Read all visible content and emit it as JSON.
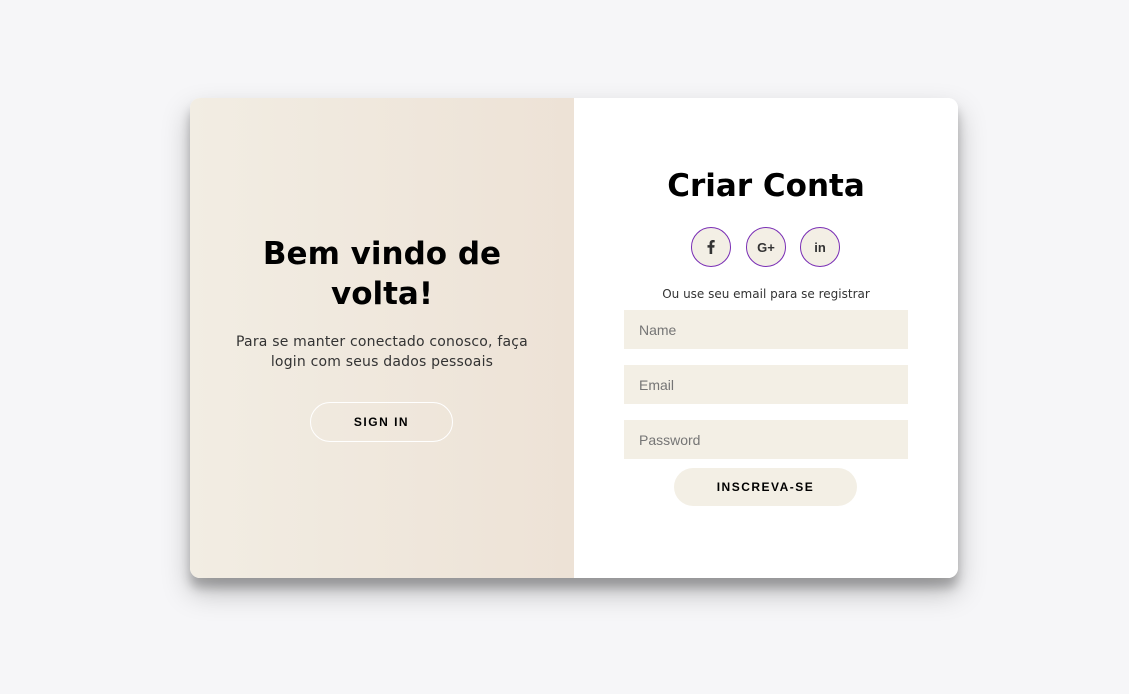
{
  "overlay": {
    "title": "Bem vindo de volta!",
    "text": "Para se manter conectado conosco, faça login com seus dados pessoais",
    "sign_in_label": "SIGN IN"
  },
  "signup": {
    "title": "Criar Conta",
    "socials": [
      {
        "icon": "facebook-icon",
        "label": "f"
      },
      {
        "icon": "google-plus-icon",
        "label": "G+"
      },
      {
        "icon": "linkedin-icon",
        "label": "in"
      }
    ],
    "hint": "Ou use seu email para se registrar",
    "name_placeholder": "Name",
    "email_placeholder": "Email",
    "password_placeholder": "Password",
    "submit_label": "INSCREVA-SE"
  },
  "colors": {
    "background": "#f6f6f8",
    "overlay_gradient_start": "#f2ede3",
    "overlay_gradient_end": "#ede2d6",
    "field_background": "#f3efe5",
    "social_border": "#7a2fb5",
    "text": "#000000"
  }
}
